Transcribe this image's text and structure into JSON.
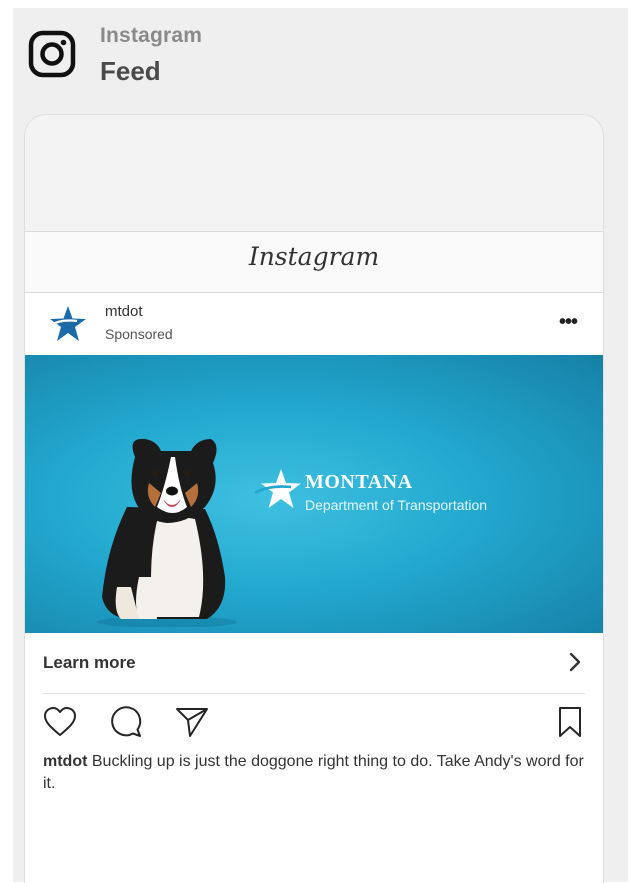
{
  "header": {
    "app_name": "Instagram",
    "title": "Feed",
    "icon": "instagram-logo-icon"
  },
  "card": {
    "wordmark": "Instagram",
    "post": {
      "username": "mtdot",
      "sponsored_label": "Sponsored",
      "avatar_icon": "mdt-star-icon",
      "more_icon": "more-options-icon",
      "more_glyph": "•••"
    },
    "ad": {
      "brand_name": "MONTANA",
      "brand_subtitle": "Department of Transportation",
      "background_color": "#22a8cf"
    },
    "cta": {
      "label": "Learn more",
      "icon": "chevron-right-icon"
    },
    "actions": {
      "like_icon": "heart-icon",
      "comment_icon": "comment-icon",
      "share_icon": "send-icon",
      "save_icon": "bookmark-icon"
    },
    "caption": {
      "username": "mtdot",
      "text": " Buckling up is just the doggone right thing to do. Take Andy's word for it."
    }
  }
}
